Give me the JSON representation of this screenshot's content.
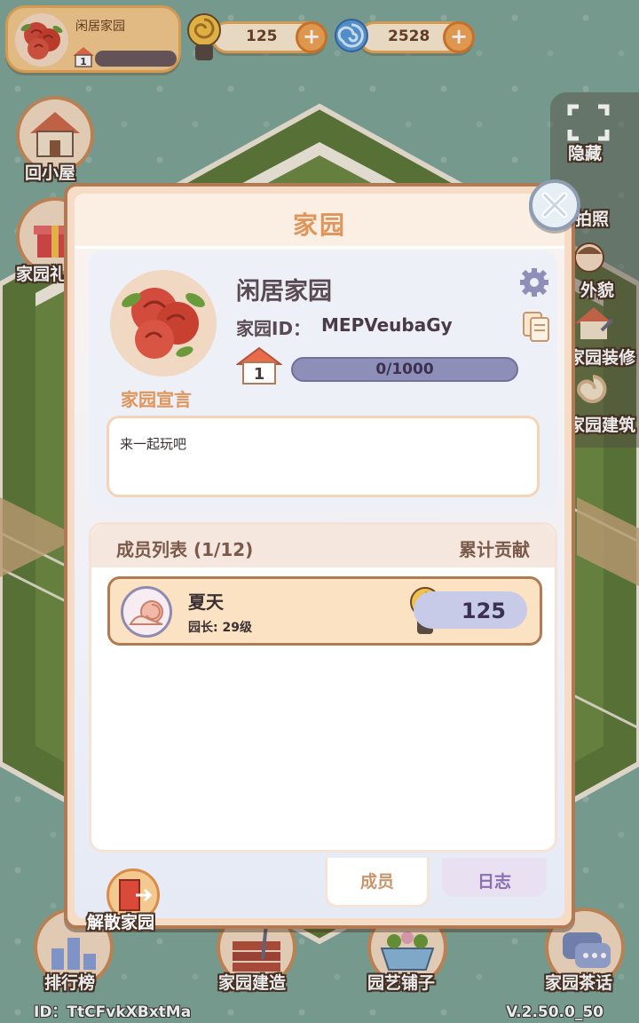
{
  "hud": {
    "home_name": "闲居家园",
    "home_level": "1",
    "snail_currency": "125",
    "gem_currency": "2528",
    "plus_symbol": "+"
  },
  "side_left": [
    {
      "label": "回小屋",
      "icon": "house-icon"
    },
    {
      "label": "家园礼",
      "icon": "gift-icon"
    }
  ],
  "side_right": [
    {
      "label": "隐藏",
      "icon": "hide-icon"
    },
    {
      "label": "拍照",
      "icon": "camera-icon"
    },
    {
      "label": "外貌",
      "icon": "avatar-icon"
    },
    {
      "label": "家园装修",
      "icon": "decorate-icon"
    },
    {
      "label": "家园建筑",
      "icon": "building-icon"
    }
  ],
  "bottom_nav": [
    {
      "label": "排行榜",
      "icon": "leaderboard-icon"
    },
    {
      "label": "家园建造",
      "icon": "build-icon"
    },
    {
      "label": "园艺铺子",
      "icon": "shop-icon"
    },
    {
      "label": "家园茶话",
      "icon": "chat-icon"
    }
  ],
  "footer": {
    "user_id": "ID：TtCFvkXBxtMa",
    "version": "V.2.50.0_50"
  },
  "modal": {
    "title": "家园",
    "home_name": "闲居家园",
    "home_id_label": "家园ID：",
    "home_id_value": "MEPVeubaGy",
    "level": "1",
    "progress_text": "0/1000",
    "progress_fraction": 0,
    "declaration_label": "家园宣言",
    "declaration_text": "来一起玩吧",
    "members_title": "成员列表 (1/12)",
    "contribution_title": "累计贡献",
    "members": [
      {
        "name": "夏天",
        "role_level": "园长: 29级",
        "contribution": "125"
      }
    ],
    "tabs": {
      "members": "成员",
      "log": "日志"
    },
    "disband_label": "解散家园"
  },
  "colors": {
    "accent_orange": "#e0955a",
    "panel_border": "#b07a55",
    "progress_bg": "#8d8fb8",
    "background": "#7fa79a"
  }
}
